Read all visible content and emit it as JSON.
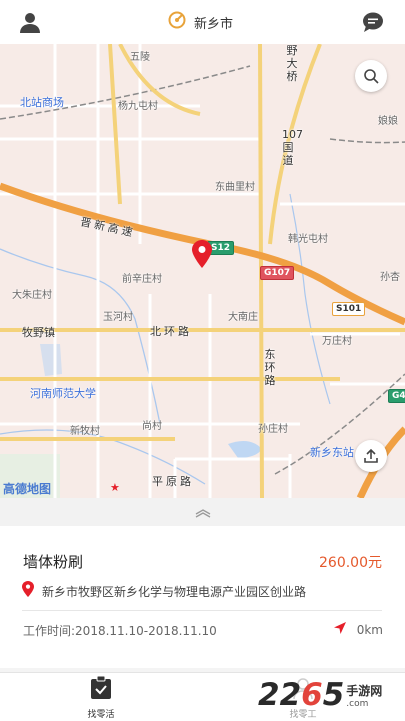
{
  "header": {
    "city": "新乡市",
    "user_icon": "user-icon",
    "chat_icon": "chat-bubble-icon",
    "location_icon": "location-compass-icon"
  },
  "map": {
    "labels": {
      "wuling": "五陵",
      "beizhan": "北站商场",
      "yangjiu": "杨九屯村",
      "niangjiao": "娘娘",
      "dongqu": "东曲里村",
      "hanguang": "韩光屯村",
      "sunxing": "孙杏",
      "qianxin": "前辛庄村",
      "dazhu": "大朱庄村",
      "yuhe": "玉河村",
      "danan": "大南庄",
      "wanzhuang": "万庄村",
      "henan": "河南师范大学",
      "xinmu": "新牧村",
      "shang": "尚村",
      "sunzhuang": "孙庄村",
      "dongzhan": "新乡东站"
    },
    "roads": {
      "jinxin": "晋新高速",
      "beihuan": "北环路",
      "muye": "牧野镇",
      "pingyuan": "平原路",
      "yedaqiao": "野大桥",
      "g107": "107国道",
      "donghuan": "东环路"
    },
    "shields": {
      "s512": "S12",
      "g107": "G107",
      "s101": "S101",
      "g4": "G4"
    },
    "watermark": "高德地图",
    "search_icon": "search-icon",
    "share_icon": "share-icon",
    "pin_icon": "map-pin-icon"
  },
  "job": {
    "title": "墙体粉刷",
    "price": "260.00元",
    "address": "新乡市牧野区新乡化学与物理电源产业园区创业路",
    "time": "工作时间:2018.11.10-2018.11.10",
    "distance": "0km",
    "expand_icon": "chevron-up-icon"
  },
  "tabs": [
    {
      "label": "找零活",
      "icon": "clipboard-check-icon"
    },
    {
      "label": "找零工",
      "icon": "person-icon"
    }
  ],
  "brand": {
    "number": "2265",
    "name": "手游网",
    "url": ".com"
  }
}
